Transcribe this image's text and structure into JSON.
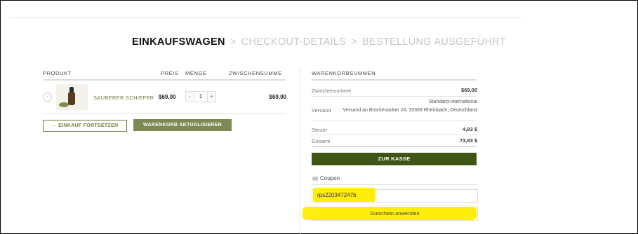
{
  "steps": {
    "current": "EINKAUFSWAGEN",
    "separator": ">",
    "step2": "CHECKOUT-DETAILS",
    "step3": "BESTELLUNG AUSGEFÜHRT"
  },
  "cart": {
    "headers": {
      "product": "PRODUKT",
      "price": "PREIS",
      "quantity": "MENGE",
      "subtotal": "ZWISCHENSUMME"
    },
    "items": [
      {
        "remove_icon": "×",
        "name": "SAUBERER SCHIEFER",
        "price": "$69,00",
        "quantity": "1",
        "minus": "-",
        "plus": "+",
        "subtotal": "$69,00"
      }
    ],
    "continue_label": "← EINKAUF FORTSETZEN",
    "update_label": "WARENKORB AKTUALISIEREN"
  },
  "totals": {
    "title": "WARENKORBSUMMEN",
    "subtotal_label": "Zwischensumme",
    "subtotal_value": "$69,00",
    "shipping_label": "Versand",
    "shipping_method": "Standard-International",
    "shipping_address": "Versand an Brückenacker 24, 33359 Rheinbach, Deutschland",
    "tax_label": "Steuer",
    "tax_value": "4,83 $",
    "total_label": "Gesamt",
    "total_value": "73,83 $",
    "checkout_label": "ZUR KASSE",
    "coupon_label": "Coupon",
    "coupon_value": "rps220347247b",
    "apply_label": "Gutschein anwenden"
  },
  "colors": {
    "accent_green": "#6d7e40",
    "button_green": "#7d8a55",
    "checkout_green": "#3f5513",
    "highlight_yellow": "#ffed0b"
  },
  "icons": {
    "tag": "tag-icon",
    "remove": "remove-icon"
  }
}
